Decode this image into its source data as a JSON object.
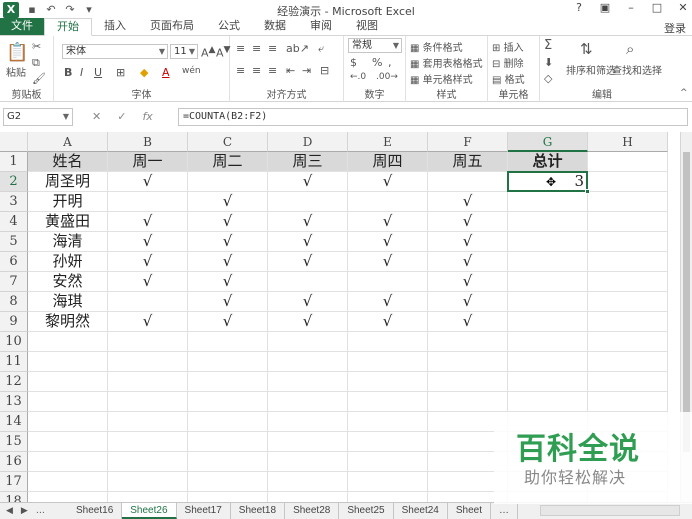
{
  "window": {
    "title": "经验演示 - Microsoft Excel"
  },
  "tabs": [
    "文件",
    "开始",
    "插入",
    "页面布局",
    "公式",
    "数据",
    "审阅",
    "视图"
  ],
  "active_tab": "开始",
  "login": "登录",
  "ribbon": {
    "clipboard": {
      "label": "剪贴板",
      "paste": "粘贴"
    },
    "font": {
      "label": "字体",
      "name": "宋体",
      "size": "11"
    },
    "alignment": {
      "label": "对齐方式"
    },
    "number": {
      "label": "数字",
      "format": "常规"
    },
    "styles": {
      "label": "样式",
      "cond": "条件格式",
      "table": "套用表格格式",
      "cell": "单元格样式"
    },
    "cells": {
      "label": "单元格",
      "insert": "插入",
      "delete": "删除",
      "format": "格式"
    },
    "editing": {
      "label": "编辑",
      "sort": "排序和筛选",
      "find": "查找和选择"
    }
  },
  "formula_bar": {
    "name_box": "G2",
    "formula": "=COUNTA(B2:F2)"
  },
  "columns": [
    "A",
    "B",
    "C",
    "D",
    "E",
    "F",
    "G",
    "H"
  ],
  "rows": [
    "1",
    "2",
    "3",
    "4",
    "5",
    "6",
    "7",
    "8",
    "9",
    "10",
    "11",
    "12",
    "13",
    "14",
    "15",
    "16",
    "17",
    "18"
  ],
  "sheet": {
    "header": [
      "姓名",
      "周一",
      "周二",
      "周三",
      "周四",
      "周五",
      "总计"
    ],
    "data": [
      [
        "周圣明",
        "√",
        "",
        "√",
        "√",
        "",
        "3"
      ],
      [
        "开明",
        "",
        "√",
        "",
        "",
        "√",
        ""
      ],
      [
        "黄盛田",
        "√",
        "√",
        "√",
        "√",
        "√",
        ""
      ],
      [
        "海清",
        "√",
        "√",
        "√",
        "√",
        "√",
        ""
      ],
      [
        "孙妍",
        "√",
        "√",
        "√",
        "√",
        "√",
        ""
      ],
      [
        "安然",
        "√",
        "√",
        "",
        "",
        "√",
        ""
      ],
      [
        "海琪",
        "",
        "√",
        "√",
        "√",
        "√",
        ""
      ],
      [
        "黎明然",
        "√",
        "√",
        "√",
        "√",
        "√",
        ""
      ]
    ]
  },
  "sheet_tabs": [
    "Sheet16",
    "Sheet26",
    "Sheet17",
    "Sheet18",
    "Sheet28",
    "Sheet25",
    "Sheet24",
    "Sheet"
  ],
  "active_sheet": "Sheet26",
  "watermark": {
    "title": "百科全说",
    "subtitle": "助你轻松解决"
  }
}
